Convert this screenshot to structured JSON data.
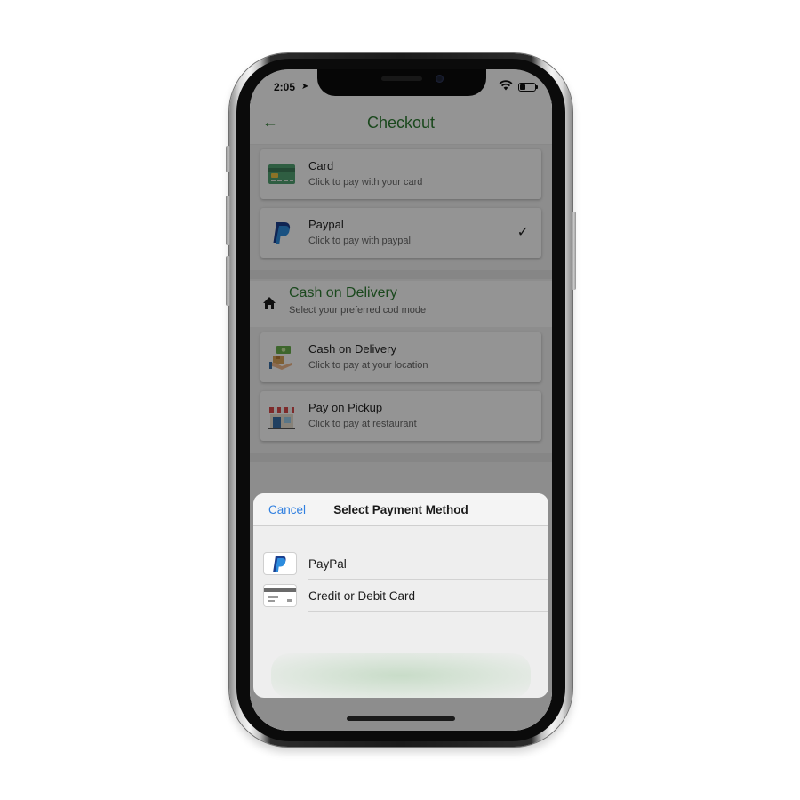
{
  "status_bar": {
    "time": "2:05"
  },
  "header": {
    "title": "Checkout"
  },
  "payment_options": [
    {
      "title": "Card",
      "subtitle": "Click to pay with your card",
      "icon": "credit-card-icon"
    },
    {
      "title": "Paypal",
      "subtitle": "Click to pay with paypal",
      "icon": "paypal-icon",
      "selected": true
    }
  ],
  "cod_section": {
    "title": "Cash on Delivery",
    "subtitle": "Select your preferred cod mode",
    "icon": "home-icon",
    "options": [
      {
        "title": "Cash on Delivery",
        "subtitle": "Click to pay at your location",
        "icon": "cash-delivery-icon"
      },
      {
        "title": "Pay on Pickup",
        "subtitle": "Click to pay at restaurant",
        "icon": "store-icon"
      }
    ]
  },
  "sheet": {
    "cancel_label": "Cancel",
    "title": "Select Payment Method",
    "methods": [
      {
        "label": "PayPal",
        "icon": "paypal-icon"
      },
      {
        "label": "Credit or Debit Card",
        "icon": "card-icon"
      }
    ]
  },
  "colors": {
    "accent_green": "#2e7d32",
    "ios_blue": "#2f7fe0",
    "overlay": "rgba(0,0,0,0.42)"
  }
}
